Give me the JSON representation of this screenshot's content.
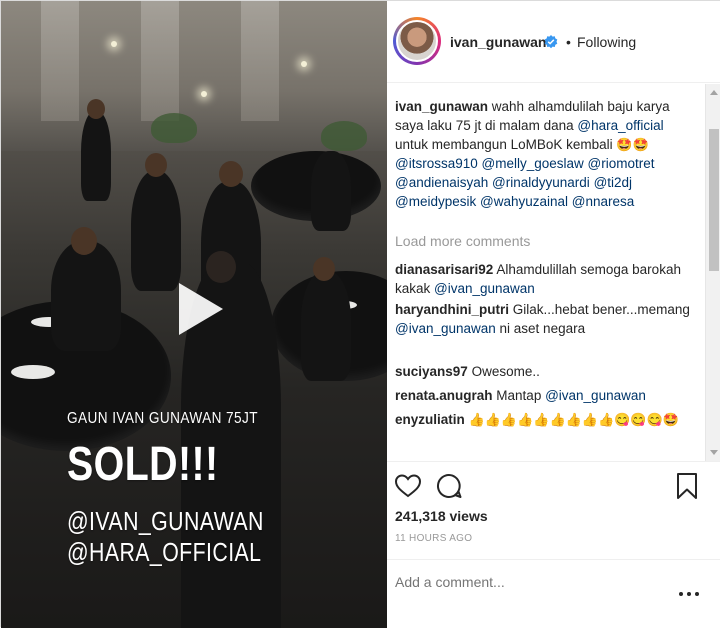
{
  "post": {
    "username": "ivan_gunawan",
    "follow_status": "Following",
    "separator": "•",
    "video_overlay": {
      "line1": "GAUN IVAN GUNAWAN 75JT",
      "line2": "SOLD!!!",
      "line3": "@IVAN_GUNAWAN",
      "line4": "@HARA_OFFICIAL"
    }
  },
  "caption": {
    "user": "ivan_gunawan",
    "text_a": "wahh alhamdulilah baju karya saya laku 75 jt di malam dana ",
    "mention_a": "@hara_official",
    "text_b": " untuk membangun LoMBoK kembali ",
    "emoji_a": "🤩🤩",
    "mention_b": "@itsrossa910",
    "mention_c": "@melly_goeslaw",
    "mention_d": "@riomotret",
    "mention_e": "@andienaisyah",
    "mention_f": "@rinaldyyunardi",
    "mention_g": "@ti2dj",
    "mention_h": "@meidypesik",
    "mention_i": "@wahyuzainal",
    "mention_j": "@nnaresa"
  },
  "load_more": "Load more comments",
  "comments": [
    {
      "user": "dianasarisari92",
      "text": "Alhamdulillah semoga barokah kakak ",
      "mention": "@ivan_gunawan",
      "tail": ""
    },
    {
      "user": "haryandhini_putri",
      "text": "Gilak...hebat bener...memang ",
      "mention": "@ivan_gunawan",
      "tail": " ni aset negara"
    },
    {
      "user": "suciyans97",
      "text": "Owesome..",
      "mention": "",
      "tail": ""
    },
    {
      "user": "renata.anugrah",
      "text": "Mantap ",
      "mention": "@ivan_gunawan",
      "tail": ""
    },
    {
      "user": "enyzuliatin",
      "text": "👍👍👍👍👍👍👍👍👍😋😋😋🤩",
      "mention": "",
      "tail": ""
    }
  ],
  "stats": {
    "views": "241,318 views",
    "time": "11 HOURS AGO"
  },
  "add_comment": {
    "placeholder": "Add a comment..."
  },
  "icons": {
    "like": "heart-icon",
    "comment": "comment-icon",
    "save": "bookmark-icon",
    "more": "more-options-icon",
    "play": "play-icon",
    "verified": "verified-badge-icon"
  },
  "colors": {
    "mention": "#003569",
    "verified": "#3897f0",
    "muted": "#999999"
  }
}
